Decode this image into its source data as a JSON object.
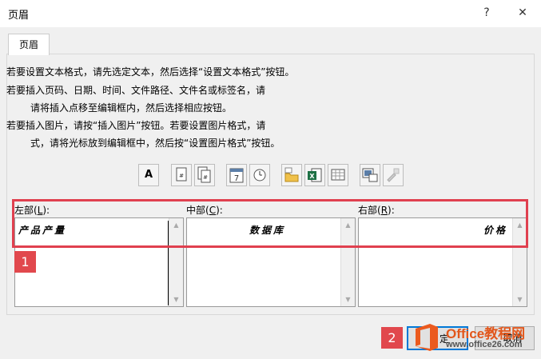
{
  "window": {
    "title": "页眉",
    "help": "?",
    "close": "✕"
  },
  "tab": {
    "label": "页眉"
  },
  "instructions": [
    "若要设置文本格式，请先选定文本，然后选择“设置文本格式”按钮。",
    "若要插入页码、日期、时间、文件路径、文件名或标签名，请",
    "请将插入点移至编辑框内，然后选择相应按钮。",
    "若要插入图片，请按“插入图片”按钮。若要设置图片格式，请",
    "式，请将光标放到编辑框中，然后按“设置图片格式”按钮。"
  ],
  "toolbar": {
    "format_text_label": "A",
    "date_label": "7"
  },
  "sections": {
    "left": {
      "label_prefix": "左部(",
      "label_key": "L",
      "label_suffix": "):",
      "value": "产品产量"
    },
    "center": {
      "label_prefix": "中部(",
      "label_key": "C",
      "label_suffix": "):",
      "value": "数据库"
    },
    "right": {
      "label_prefix": "右部(",
      "label_key": "R",
      "label_suffix": "):",
      "value": "价格"
    }
  },
  "badges": {
    "first": "1",
    "second": "2"
  },
  "buttons": {
    "ok": "定",
    "cancel": "取消"
  },
  "watermark": {
    "brand": "Office教程网",
    "url": "www.office26.com"
  },
  "colors": {
    "highlight": "#e0404f",
    "badge": "#e1484d",
    "ok_border": "#0078d7",
    "logo": "#eb5a1e"
  }
}
